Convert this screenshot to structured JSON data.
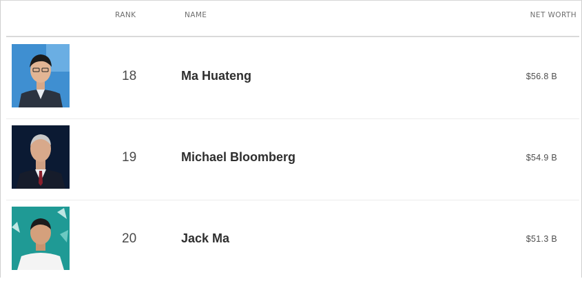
{
  "header": {
    "rank_label": "RANK",
    "name_label": "NAME",
    "net_worth_label": "NET WORTH"
  },
  "rows": [
    {
      "rank": "18",
      "name": "Ma Huateng",
      "net_worth": "$56.8 B",
      "photo_icon": "person-photo-icon"
    },
    {
      "rank": "19",
      "name": "Michael Bloomberg",
      "net_worth": "$54.9 B",
      "photo_icon": "person-photo-icon"
    },
    {
      "rank": "20",
      "name": "Jack Ma",
      "net_worth": "$51.3 B",
      "photo_icon": "person-photo-icon"
    }
  ],
  "colors": {
    "header_divider": "#d9d9d9",
    "row_divider": "#ececec",
    "photo_bg_1": "#3f8fd1",
    "photo_bg_2": "#0b1a33",
    "photo_bg_3": "#1f9a95"
  }
}
